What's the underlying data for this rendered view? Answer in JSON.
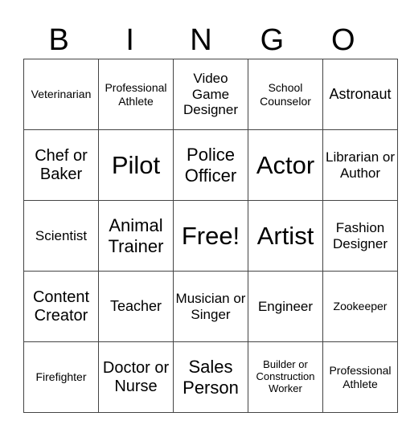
{
  "header": {
    "letters": [
      "B",
      "I",
      "N",
      "G",
      "O"
    ]
  },
  "grid": {
    "rows": [
      [
        "Veterinarian",
        "Professional Athlete",
        "Video Game Designer",
        "School Counselor",
        "Astronaut"
      ],
      [
        "Chef or Baker",
        "Pilot",
        "Police Officer",
        "Actor",
        "Librarian or Author"
      ],
      [
        "Scientist",
        "Animal Trainer",
        "Free!",
        "Artist",
        "Fashion Designer"
      ],
      [
        "Content Creator",
        "Teacher",
        "Musician or Singer",
        "Engineer",
        "Zookeeper"
      ],
      [
        "Firefighter",
        "Doctor or Nurse",
        "Sales Person",
        "Builder or Construction Worker",
        "Professional Athlete"
      ]
    ]
  }
}
